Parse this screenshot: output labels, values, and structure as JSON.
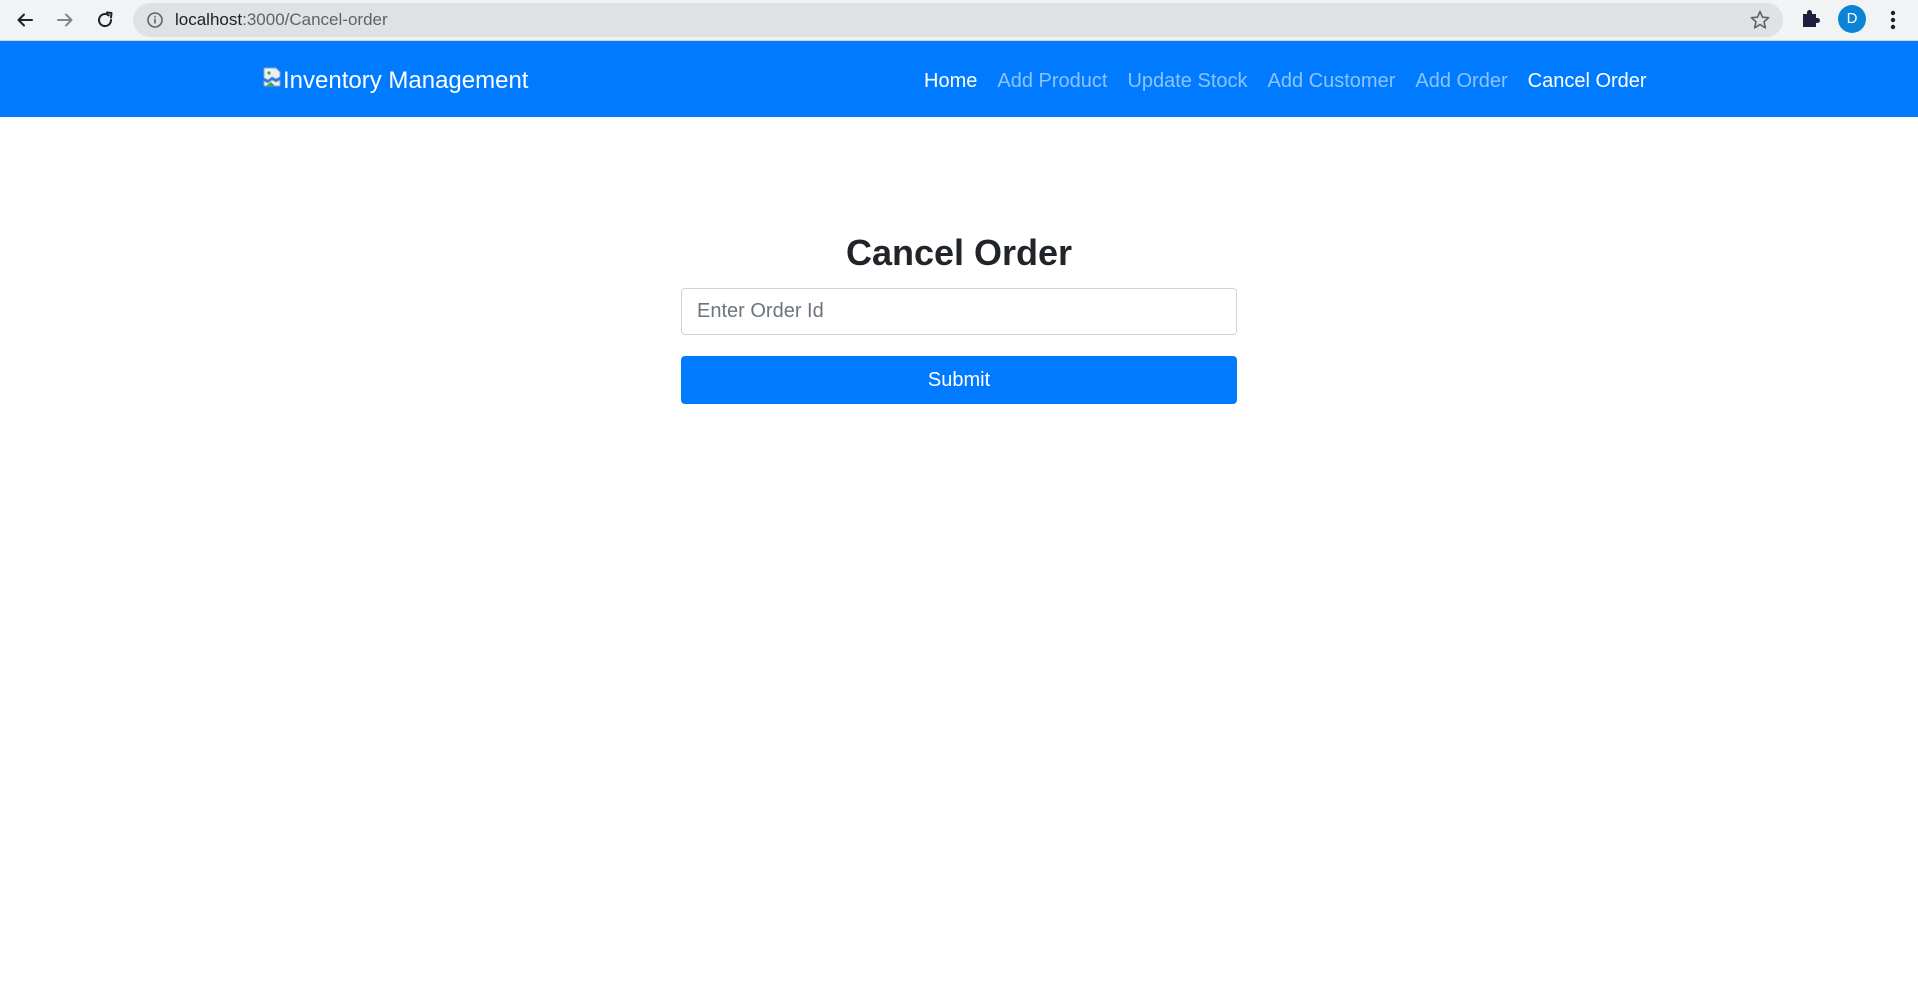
{
  "browser": {
    "url_host": "localhost",
    "url_path": ":3000/Cancel-order",
    "profile_initial": "D",
    "icons": [
      "back-icon",
      "forward-icon",
      "reload-icon",
      "info-icon",
      "star-icon",
      "extensions-icon",
      "kebab-menu-icon"
    ]
  },
  "navbar": {
    "brand_label": "Inventory Management",
    "links": [
      {
        "label": "Home",
        "active": true
      },
      {
        "label": "Add Product",
        "active": false
      },
      {
        "label": "Update Stock",
        "active": false
      },
      {
        "label": "Add Customer",
        "active": false
      },
      {
        "label": "Add Order",
        "active": false
      },
      {
        "label": "Cancel Order",
        "active": true
      }
    ]
  },
  "form": {
    "title": "Cancel Order",
    "order_id_placeholder": "Enter Order Id",
    "order_id_value": "",
    "submit_label": "Submit"
  },
  "colors": {
    "primary": "#007bff",
    "nav_inactive": "rgba(255,255,255,0.55)",
    "heading": "#212529"
  }
}
